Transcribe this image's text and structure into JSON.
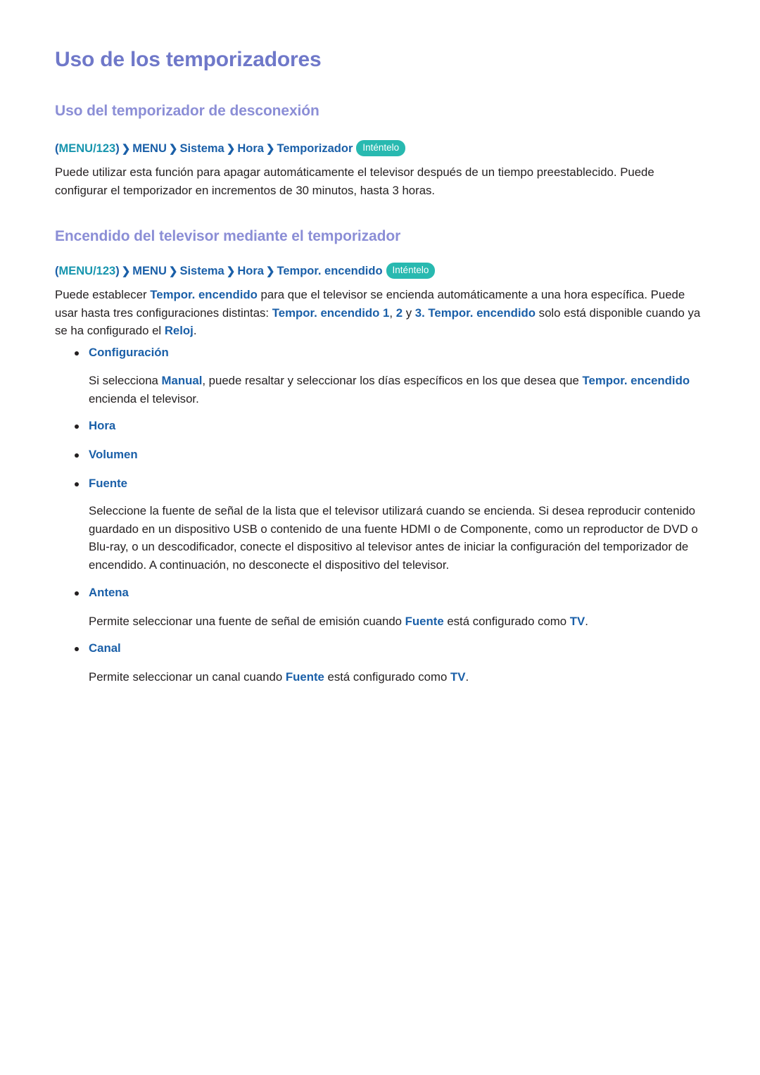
{
  "document": {
    "title": "Uso de los temporizadores"
  },
  "colors": {
    "title": "#6f78c9",
    "section_heading": "#8b8ed6",
    "link_blue": "#1a5fa8",
    "teal": "#1795ae",
    "badge_bg": "#28b9b0",
    "body": "#231f20"
  },
  "sections": [
    {
      "heading": "Uso del temporizador de desconexión",
      "breadcrumb": {
        "open_paren": "(",
        "first": "MENU/123",
        "close_paren": ")",
        "separator": "❯",
        "items": [
          "MENU",
          "Sistema",
          "Hora",
          "Temporizador"
        ],
        "badge": "Inténtelo"
      },
      "paragraph": {
        "line1": "Puede utilizar esta función para apagar automáticamente el televisor después de un tiempo preestablecido. Puede",
        "line2": "configurar el temporizador en incrementos de 30 minutos, hasta 3 horas.",
        "full": "Puede utilizar esta función para apagar automáticamente el televisor después de un tiempo preestablecido. Puede configurar el temporizador en incrementos de 30 minutos, hasta 3 horas."
      }
    },
    {
      "heading": "Encendido del televisor mediante el temporizador",
      "breadcrumb": {
        "open_paren": "(",
        "first": "MENU/123",
        "close_paren": ")",
        "separator": "❯",
        "items": [
          "MENU",
          "Sistema",
          "Hora",
          "Tempor. encendido"
        ],
        "badge": "Inténtelo"
      },
      "intro": {
        "t1": "Puede establecer ",
        "b1": "Tempor. encendido",
        "t2": " para que el televisor se encienda automáticamente a una hora específica. Puede usar hasta tres configuraciones distintas: ",
        "b2": "Tempor. encendido 1",
        "t3": ", ",
        "b3": "2",
        "t4": " y ",
        "b4": "3. Tempor. encendido",
        "t5": " solo está disponible cuando ya se ha configurado el ",
        "b5": "Reloj",
        "t6": "."
      },
      "bullets": [
        {
          "label": "Configuración",
          "description": {
            "t1": "Si selecciona ",
            "b1": "Manual",
            "t2": ", puede resaltar y seleccionar los días específicos en los que desea que ",
            "b2": "Tempor. encendido",
            "t3": " encienda el televisor."
          }
        },
        {
          "label": "Hora",
          "description": null
        },
        {
          "label": "Volumen",
          "description": null
        },
        {
          "label": "Fuente",
          "description": {
            "t1": "Seleccione la fuente de señal de la lista que el televisor utilizará cuando se encienda. Si desea reproducir contenido guardado en un dispositivo USB o contenido de una fuente HDMI o de Componente, como un reproductor de DVD o Blu-ray, o un descodificador, conecte el dispositivo al televisor antes de iniciar la configuración del temporizador de encendido. A continuación, no desconecte el dispositivo del televisor."
          }
        },
        {
          "label": "Antena",
          "description": {
            "t1": "Permite seleccionar una fuente de señal de emisión cuando ",
            "b1": "Fuente",
            "t2": " está configurado como ",
            "b2": "TV",
            "t3": "."
          }
        },
        {
          "label": "Canal",
          "description": {
            "t1": "Permite seleccionar un canal cuando ",
            "b1": "Fuente",
            "t2": " está configurado como ",
            "b2": "TV",
            "t3": "."
          }
        }
      ]
    }
  ]
}
